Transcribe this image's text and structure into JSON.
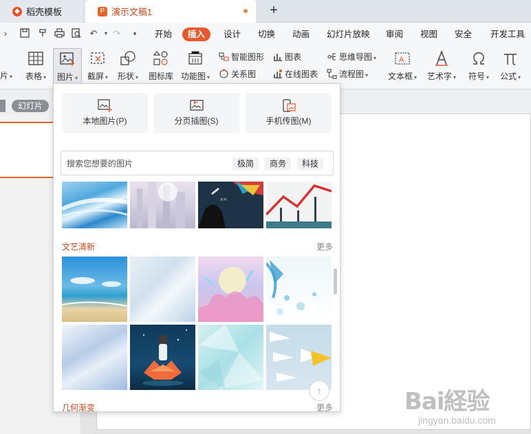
{
  "tabs": [
    {
      "label": "稻壳模板",
      "icon": "docer-icon"
    },
    {
      "label": "演示文稿1",
      "icon": "presentation-icon",
      "modified": true
    }
  ],
  "menu": [
    "开始",
    "插入",
    "设计",
    "切换",
    "动画",
    "幻灯片放映",
    "审阅",
    "视图",
    "安全",
    "开发工具"
  ],
  "menu_active": "插入",
  "ribbon": {
    "table": "表格",
    "picture": "图片",
    "screenshot": "截屏",
    "shape": "形状",
    "icon_lib": "图标库",
    "function_chart": "功能图",
    "smart_art": "智能图形",
    "chart": "图表",
    "relation": "关系图",
    "online_chart": "在线图表",
    "mindmap": "思维导图",
    "flowchart": "流程图",
    "textbox": "文本框",
    "wordart": "艺术字",
    "symbol": "符号",
    "formula": "公式",
    "left_cut": "片"
  },
  "slide_pill": "幻灯片",
  "panel": {
    "local": "本地图片(P)",
    "paged": "分页插图(S)",
    "phone": "手机传图(M)",
    "search_placeholder": "搜索您想要的图片",
    "tags": [
      "极简",
      "商务",
      "科技"
    ],
    "section1": "文艺清新",
    "section2": "几何渐变",
    "more": "更多",
    "back_top": "↑"
  },
  "watermark": {
    "main": "Bai経验",
    "sub": "jingyan.baidu.com"
  },
  "colors": {
    "accent": "#e9572c",
    "section": "#d04a1e"
  }
}
